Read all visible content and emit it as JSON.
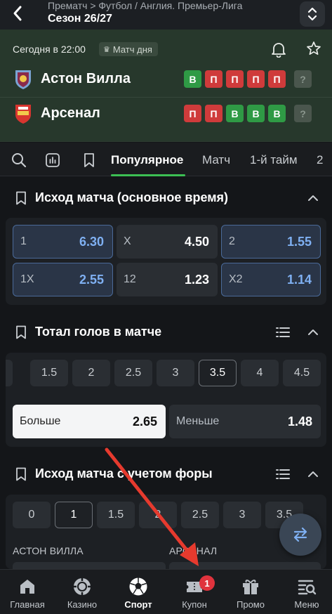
{
  "header": {
    "breadcrumb": "Прематч > Футбол / Англия. Премьер-Лига",
    "season": "Сезон 26/27"
  },
  "match": {
    "time": "Сегодня в 22:00",
    "match_of_day": "Матч дня",
    "home": {
      "name": "Астон Вилла",
      "form": [
        "В",
        "П",
        "П",
        "П",
        "П"
      ],
      "form_unknown": "?"
    },
    "away": {
      "name": "Арсенал",
      "form": [
        "П",
        "П",
        "В",
        "В",
        "В"
      ],
      "form_unknown": "?"
    },
    "colors": {
      "win": "#2f9a45",
      "loss": "#cf3b3b",
      "bg": "#27382c"
    }
  },
  "tabs": {
    "items": [
      "Популярное",
      "Матч",
      "1-й тайм",
      "2"
    ],
    "active": "Популярное",
    "accent": "#3cbf54"
  },
  "outcome": {
    "title": "Исход матча (основное время)",
    "row1": [
      {
        "label": "1",
        "value": "6.30"
      },
      {
        "label": "X",
        "value": "4.50"
      },
      {
        "label": "2",
        "value": "1.55"
      }
    ],
    "row2": [
      {
        "label": "1X",
        "value": "2.55"
      },
      {
        "label": "12",
        "value": "1.23"
      },
      {
        "label": "X2",
        "value": "1.14"
      }
    ]
  },
  "total": {
    "title": "Тотал голов в матче",
    "lines": [
      "1.5",
      "2",
      "2.5",
      "3",
      "3.5",
      "4",
      "4.5"
    ],
    "selected_line": "3.5",
    "over": {
      "label": "Больше",
      "value": "2.65"
    },
    "under": {
      "label": "Меньше",
      "value": "1.48"
    }
  },
  "handicap": {
    "title": "Исход матча с учетом форы",
    "lines": [
      "0",
      "1",
      "1.5",
      "2",
      "2.5",
      "3",
      "3.5"
    ],
    "selected_line": "1",
    "home_label": "АСТОН ВИЛЛА",
    "away_label": "АРСЕНАЛ"
  },
  "bottom_nav": {
    "items": [
      {
        "label": "Главная",
        "icon": "home-icon"
      },
      {
        "label": "Казино",
        "icon": "casino-chip-icon"
      },
      {
        "label": "Спорт",
        "icon": "football-icon"
      },
      {
        "label": "Купон",
        "icon": "coupon-icon",
        "badge": "1"
      },
      {
        "label": "Промо",
        "icon": "gift-icon"
      },
      {
        "label": "Меню",
        "icon": "menu-search-icon"
      }
    ],
    "active": "Спорт"
  },
  "annotation": {
    "arrow_color": "#e63a2e"
  }
}
